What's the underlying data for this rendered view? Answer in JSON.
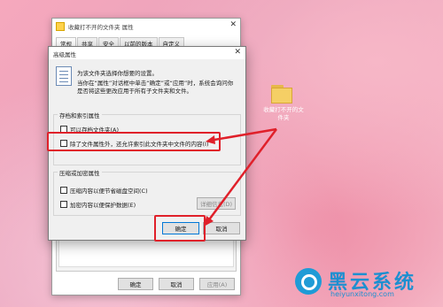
{
  "properties_window": {
    "title": "收藏打不开的文件夹 属性",
    "tabs": [
      "常规",
      "共享",
      "安全",
      "以前的版本",
      "自定义"
    ],
    "buttons": {
      "ok": "确定",
      "cancel": "取消",
      "apply": "应用(A)"
    }
  },
  "advanced_dialog": {
    "title": "高级属性",
    "description": "为该文件夹选择你想要的设置。",
    "note": "当你在“属性”对话框中单击“确定”或“应用”时，系统会询问你是否将这些更改应用于所有子文件夹和文件。",
    "archive_group": {
      "label": "存档和索引属性",
      "archive_option": "可以存档文件夹(A)",
      "index_option": "除了文件属性外，还允许索引此文件夹中文件的内容(I)"
    },
    "compress_group": {
      "label": "压缩或加密属性",
      "compress_option": "压缩内容以便节省磁盘空间(C)",
      "encrypt_option": "加密内容以便保护数据(E)",
      "details_button": "详细信息(D)"
    },
    "buttons": {
      "ok": "确定",
      "cancel": "取消"
    }
  },
  "desktop": {
    "folder_label": "收藏打不开的文件夹"
  },
  "watermark": {
    "title": "黑云系统",
    "url": "heiyunxitong.com"
  },
  "colors": {
    "annotation_red": "#e0202a",
    "watermark_blue": "#1d8fd0"
  }
}
